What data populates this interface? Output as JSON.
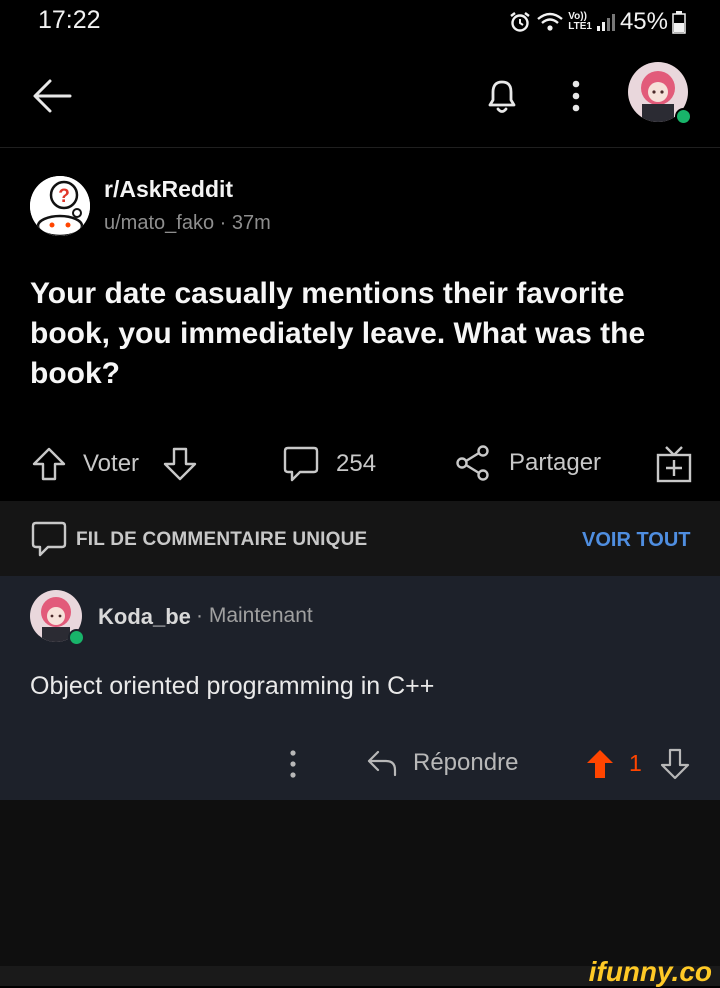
{
  "status_bar": {
    "time": "17:22",
    "volte_top": "Vo))",
    "volte_bottom": "LTE1",
    "battery": "45%"
  },
  "post": {
    "subreddit": "r/AskReddit",
    "author": "u/mato_fako",
    "time_ago": "37m",
    "meta_separator": "·",
    "title": "Your date casually mentions their favorite book, you immediately leave. What was the book?"
  },
  "actions": {
    "vote_label": "Voter",
    "comments_count": "254",
    "share_label": "Partager"
  },
  "thread": {
    "label": "FIL DE COMMENTAIRE UNIQUE",
    "see_all": "VOIR TOUT"
  },
  "comment": {
    "author": "Koda_be",
    "time": "· Maintenant",
    "body": "Object oriented programming in C++",
    "reply_label": "Répondre",
    "score": "1"
  },
  "watermark": "ifunny.co",
  "colors": {
    "background": "#000000",
    "comment_bg": "#1d212a",
    "thread_bar_bg": "#151515",
    "link_blue": "#4f8ee0",
    "upvote_orange": "#ff4500",
    "online_green": "#18b46a",
    "watermark_yellow": "#ffc926"
  }
}
